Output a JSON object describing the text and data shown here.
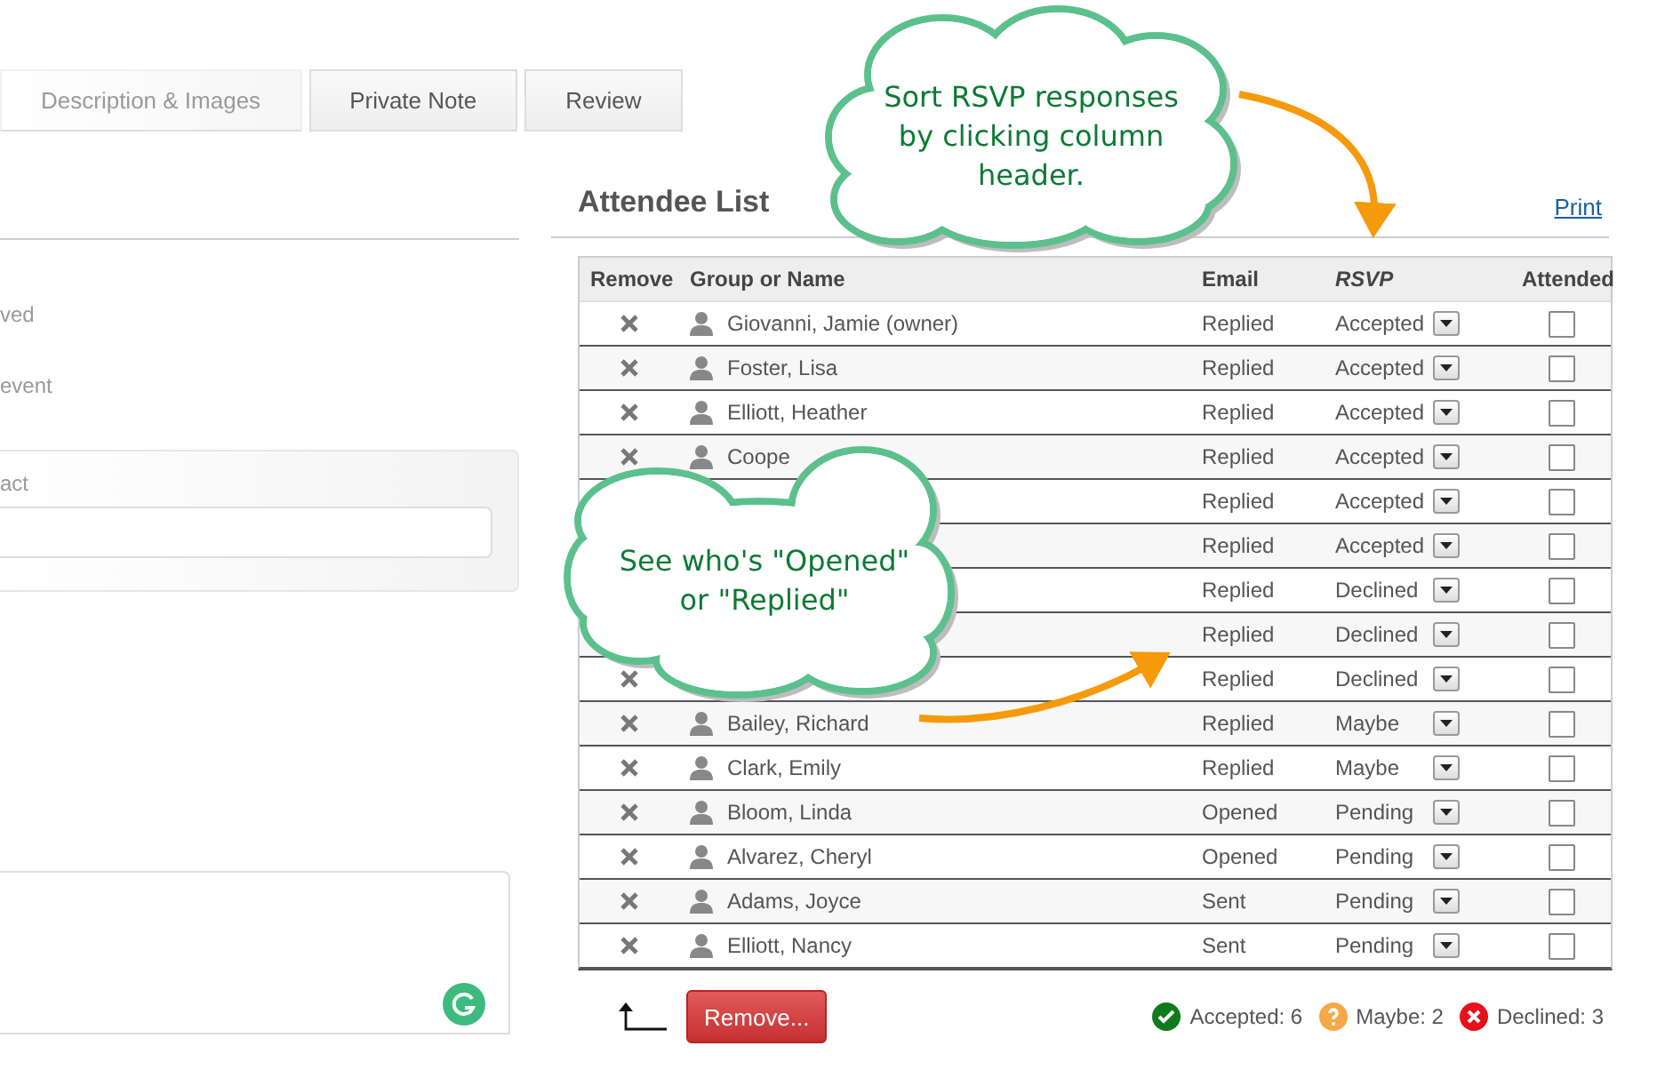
{
  "tabs": [
    {
      "label": "Description & Images",
      "selected": false,
      "faded": true
    },
    {
      "label": "Private Note",
      "selected": false,
      "faded": false
    },
    {
      "label": "Review",
      "selected": false,
      "faded": false
    }
  ],
  "left_panel": {
    "labels": [
      "ved",
      "event"
    ],
    "field_label": "act"
  },
  "attendee_list": {
    "title": "Attendee List",
    "print_link": "Print",
    "columns": [
      "Remove",
      "Group or Name",
      "Email",
      "RSVP",
      "Attended"
    ],
    "rows": [
      {
        "remove": true,
        "icon": true,
        "name": "Giovanni, Jamie (owner)",
        "email": "Replied",
        "rsvp": "Accepted",
        "attended": false
      },
      {
        "remove": true,
        "icon": true,
        "name": "Foster, Lisa",
        "email": "Replied",
        "rsvp": "Accepted",
        "attended": false
      },
      {
        "remove": true,
        "icon": true,
        "name": "Elliott, Heather",
        "email": "Replied",
        "rsvp": "Accepted",
        "attended": false
      },
      {
        "remove": true,
        "icon": true,
        "name": "Coope",
        "email": "Replied",
        "rsvp": "Accepted",
        "attended": false
      },
      {
        "remove": false,
        "icon": false,
        "email": "Replied",
        "rsvp": "Accepted",
        "attended": false
      },
      {
        "remove": false,
        "icon": false,
        "email": "Replied",
        "rsvp": "Accepted",
        "attended": false
      },
      {
        "remove": false,
        "icon": false,
        "email": "Replied",
        "rsvp": "Declined",
        "attended": false
      },
      {
        "remove": false,
        "icon": false,
        "email": "Replied",
        "rsvp": "Declined",
        "attended": false
      },
      {
        "remove": true,
        "icon": false,
        "email": "Replied",
        "rsvp": "Declined",
        "attended": false
      },
      {
        "remove": true,
        "icon": true,
        "name": "Bailey, Richard",
        "email": "Replied",
        "rsvp": "Maybe",
        "attended": false
      },
      {
        "remove": true,
        "icon": true,
        "name": "Clark, Emily",
        "email": "Replied",
        "rsvp": "Maybe",
        "attended": false
      },
      {
        "remove": true,
        "icon": true,
        "name": "Bloom, Linda",
        "email": "Opened",
        "rsvp": "Pending",
        "attended": false
      },
      {
        "remove": true,
        "icon": true,
        "name": "Alvarez, Cheryl",
        "email": "Opened",
        "rsvp": "Pending",
        "attended": false
      },
      {
        "remove": true,
        "icon": true,
        "name": "Adams, Joyce",
        "email": "Sent",
        "rsvp": "Pending",
        "attended": false
      },
      {
        "remove": true,
        "icon": true,
        "name": "Elliott, Nancy",
        "email": "Sent",
        "rsvp": "Pending",
        "attended": false
      }
    ],
    "remove_button": "Remove...",
    "summary": [
      {
        "kind": "accepted",
        "label": "Accepted: 6",
        "color": "#117a1c"
      },
      {
        "kind": "maybe",
        "label": "Maybe: 2",
        "color": "#f5a845"
      },
      {
        "kind": "declined",
        "label": "Declined: 3",
        "color": "#e8101a"
      }
    ]
  },
  "callouts": [
    {
      "text": "Sort RSVP responses by clicking column header."
    },
    {
      "text": "See who's \"Opened\" or \"Replied\""
    }
  ]
}
